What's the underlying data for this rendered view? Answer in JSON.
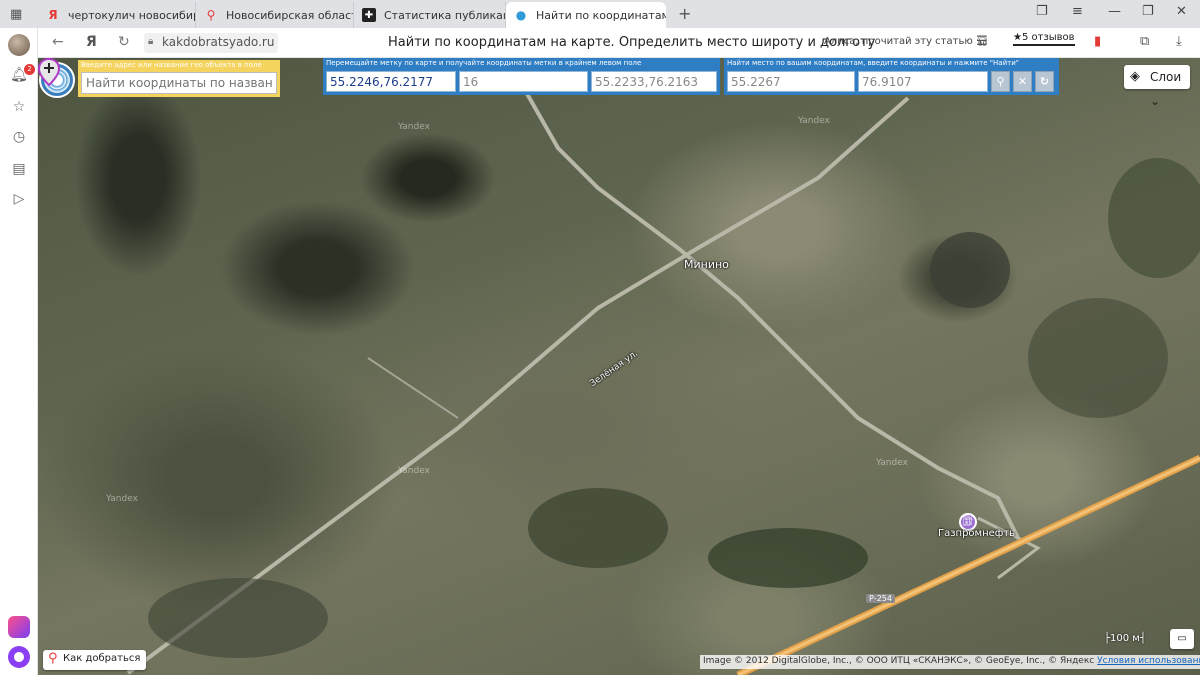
{
  "tabs": [
    {
      "icon": "Я",
      "icon_color": "#e53935",
      "label": "чертокулич новосибирск"
    },
    {
      "icon": "📍",
      "icon_color": "#e53935",
      "label": "Новосибирская область –"
    },
    {
      "icon": "✚",
      "icon_color": "#222222",
      "label": "Статистика публикаций | "
    },
    {
      "icon": "●",
      "icon_color": "#2f9bd8",
      "label": "Найти по координатам",
      "close": "✕"
    }
  ],
  "tab_plus": "+",
  "address": {
    "url": "kakdobratsyado.ru",
    "title": "Найти по координатам на карте. Определить место широту и долготу",
    "alice_prompt": "Алиса, прочитай эту статью",
    "reviews": "★5 отзывов"
  },
  "sidebar": {
    "notification_count": "2"
  },
  "search": {
    "label": "Введите адрес или название гео объекта в поле",
    "placeholder": "Найти координаты по названию"
  },
  "move_panel": {
    "label": "Перемещайте метку по карте и получайте координаты метки в крайнем левом поле",
    "marker_coords": "55.2246,76.2177",
    "zoom": "16",
    "corner_coords": "55.2233,76.2163"
  },
  "find_panel": {
    "label": "Найти место по вашим координатам, введите координаты и нажмите \"Найти\"",
    "lat": "55.2267",
    "lon": "76.9107"
  },
  "layers": {
    "label": "Слои"
  },
  "map_labels": {
    "village": "Минино",
    "street": "Зелёная ул.",
    "fuel": "Газпромнефть",
    "road": "Р-254",
    "watermark": "Yandex"
  },
  "route_button": {
    "label": "Как добраться"
  },
  "scale": {
    "label": "100 м"
  },
  "copyright": {
    "text": "Image © 2012 DigitalGlobe, Inc., © ООО ИТЦ «СКАНЭКС», © GeoEye, Inc., © Яндекс ",
    "terms": "Условия использования"
  }
}
